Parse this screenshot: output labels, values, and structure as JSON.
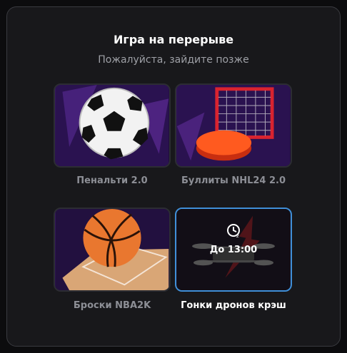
{
  "modal": {
    "title": "Игра на перерыве",
    "subtitle": "Пожалуйста, зайдите позже"
  },
  "games": [
    {
      "label": "Пенальти 2.0",
      "icon": "soccer-ball"
    },
    {
      "label": "Буллиты NHL24 2.0",
      "icon": "hockey-goal"
    },
    {
      "label": "Броски NBA2K",
      "icon": "basketball"
    },
    {
      "label": "Гонки дронов крэш",
      "icon": "drone",
      "timer": "До 13:00",
      "selected": true
    }
  ],
  "colors": {
    "accent": "#3f8fd8",
    "background": "#18181b",
    "muted_text": "#8d8f96"
  }
}
